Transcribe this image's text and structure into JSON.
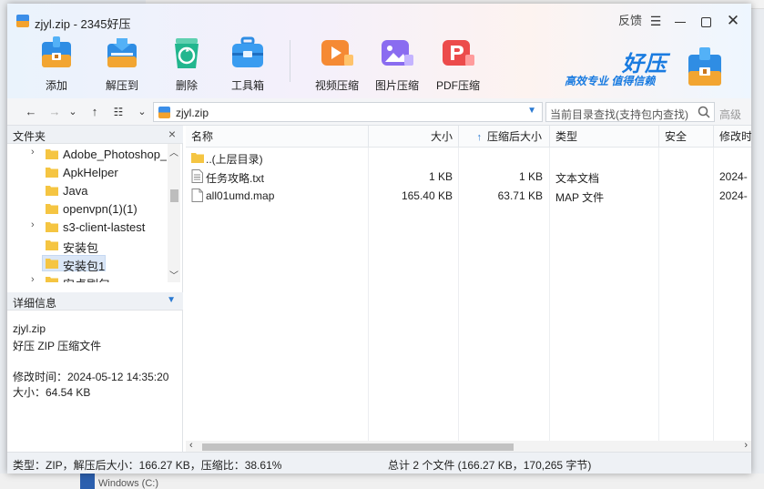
{
  "window": {
    "title": "zjyl.zip - 2345好压",
    "feedback": "反馈",
    "close": "✕"
  },
  "toolbar": {
    "tools": [
      {
        "label": "添加",
        "icon": "add-archive-icon"
      },
      {
        "label": "解压到",
        "icon": "extract-to-icon"
      },
      {
        "label": "删除",
        "icon": "delete-recycle-icon"
      },
      {
        "label": "工具箱",
        "icon": "toolbox-icon"
      },
      {
        "label": "视频压缩",
        "icon": "video-compress-icon"
      },
      {
        "label": "图片压缩",
        "icon": "image-compress-icon"
      },
      {
        "label": "PDF压缩",
        "icon": "pdf-compress-icon"
      }
    ]
  },
  "brand": {
    "name": "好压",
    "slogan": "高效专业  值得信赖"
  },
  "address": {
    "path": "zjyl.zip",
    "search_placeholder": "当前目录查找(支持包内查找)",
    "advanced": "高级"
  },
  "folders_panel": {
    "title": "文件夹",
    "items": [
      {
        "label": "Adobe_Photoshop_",
        "expandable": true
      },
      {
        "label": "ApkHelper",
        "expandable": false
      },
      {
        "label": "Java",
        "expandable": false
      },
      {
        "label": "openvpn(1)(1)",
        "expandable": false
      },
      {
        "label": "s3-client-lastest",
        "expandable": true
      },
      {
        "label": "安装包",
        "expandable": false
      },
      {
        "label": "安装包1",
        "expandable": false,
        "selected": true
      },
      {
        "label": "安卓刷包",
        "expandable": true
      }
    ]
  },
  "details_panel": {
    "title": "详细信息",
    "name": "zjyl.zip",
    "type": "好压 ZIP 压缩文件",
    "modified": "修改时间：2024-05-12 14:35:20",
    "size": "大小：64.54 KB"
  },
  "file_list": {
    "columns": [
      "名称",
      "大小",
      "压缩后大小",
      "类型",
      "安全",
      "修改时"
    ],
    "sort_indicator": "↑",
    "rows": [
      {
        "name": "..(上层目录)",
        "size": "",
        "packed": "",
        "type": "",
        "security": "",
        "modified": "",
        "icon": "folder-icon"
      },
      {
        "name": "任务攻略.txt",
        "size": "1 KB",
        "packed": "1 KB",
        "type": "文本文档",
        "security": "",
        "modified": "2024-",
        "icon": "text-file-icon"
      },
      {
        "name": "all01umd.map",
        "size": "165.40 KB",
        "packed": "63.71 KB",
        "type": "MAP 文件",
        "security": "",
        "modified": "2024-",
        "icon": "generic-file-icon"
      }
    ]
  },
  "status": {
    "left": "类型：ZIP，解压后大小：166.27 KB，压缩比：38.61%",
    "right": "总计 2 个文件 (166.27 KB，170,265 字节)"
  },
  "background": {
    "taskbar_text": "Windows (C:)"
  },
  "colors": {
    "accent": "#1a7be0",
    "folder": "#f5c542",
    "selection": "#dbe7f7"
  }
}
